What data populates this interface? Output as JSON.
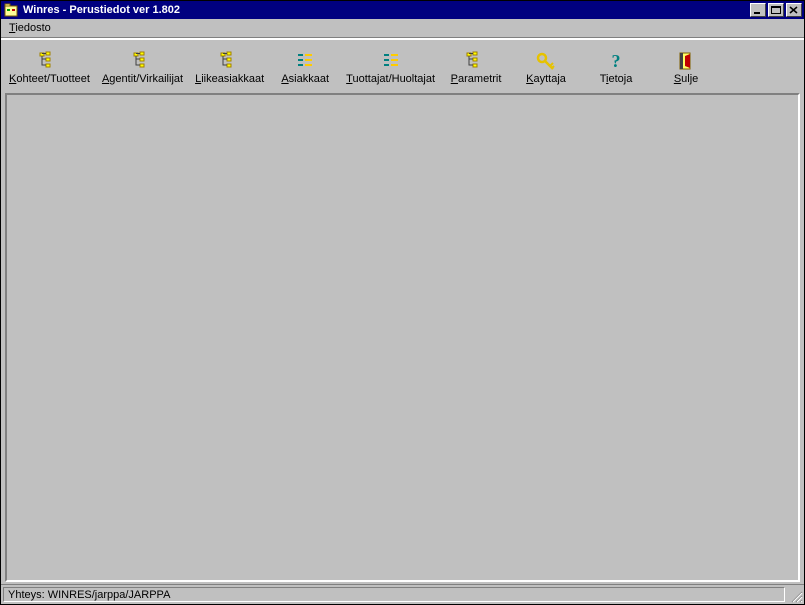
{
  "titlebar": {
    "title": "Winres - Perustiedot ver 1.802"
  },
  "menubar": {
    "file": {
      "label": "Tiedosto",
      "accel_index": 0
    }
  },
  "toolbar": {
    "items": [
      {
        "id": "kohteet",
        "label": "Kohteet/Tuotteet",
        "accel_index": 0,
        "icon": "tree-icon"
      },
      {
        "id": "agentit",
        "label": "Agentit/Virkailijat",
        "accel_index": 0,
        "icon": "tree-icon"
      },
      {
        "id": "liike",
        "label": "Liikeasiakkaat",
        "accel_index": 0,
        "icon": "tree-icon"
      },
      {
        "id": "asiakkaat",
        "label": "Asiakkaat",
        "accel_index": 0,
        "icon": "list-icon"
      },
      {
        "id": "tuottajat",
        "label": "Tuottajat/Huoltajat",
        "accel_index": 0,
        "icon": "list-icon"
      },
      {
        "id": "parametrit",
        "label": "Parametrit",
        "accel_index": 0,
        "icon": "tree-icon"
      },
      {
        "id": "kayttaja",
        "label": "Kayttaja",
        "accel_index": 0,
        "icon": "key-icon"
      },
      {
        "id": "tietoja",
        "label": "Tietoja",
        "accel_index": 1,
        "icon": "help-icon"
      },
      {
        "id": "sulje",
        "label": "Sulje",
        "accel_index": 0,
        "icon": "exit-icon"
      }
    ]
  },
  "statusbar": {
    "text": "Yhteys: WINRES/jarppa/JARPPA"
  }
}
